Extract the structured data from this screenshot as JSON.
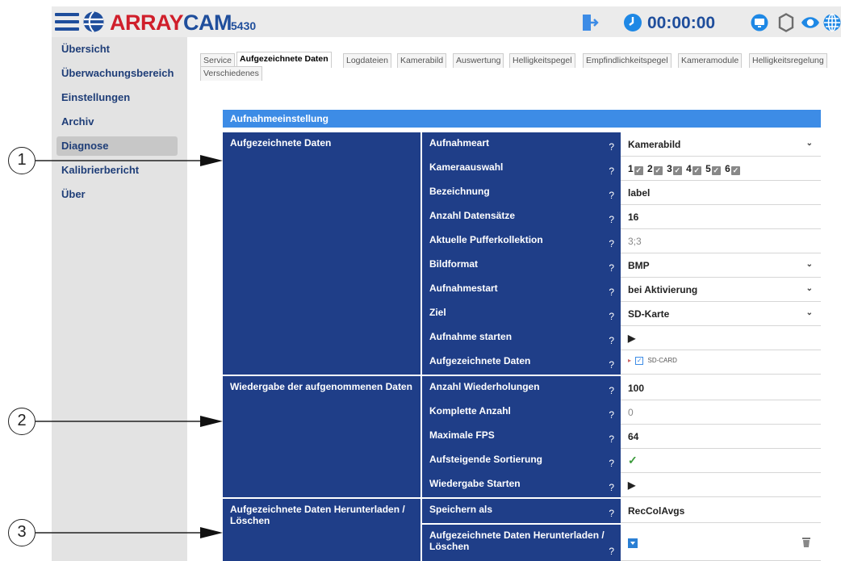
{
  "header": {
    "brand_first": "ARRAY",
    "brand_second": "CAM",
    "model": "5430",
    "timer": "00:00:00",
    "colors": {
      "brand_red": "#d01f2b",
      "brand_blue": "#1f4e9c",
      "accent": "#1e88e5"
    },
    "icons": [
      "menu-icon",
      "globe-logo-icon",
      "logout-icon",
      "clock-icon",
      "monitor-icon",
      "gear-icon",
      "eye-icon",
      "language-globe-icon"
    ]
  },
  "sidebar": {
    "items": [
      {
        "label": "Übersicht"
      },
      {
        "label": "Überwachungsbereich"
      },
      {
        "label": "Einstellungen"
      },
      {
        "label": "Archiv"
      },
      {
        "label": "Diagnose",
        "active": true
      },
      {
        "label": "Kalibrierbericht"
      },
      {
        "label": "Über"
      }
    ]
  },
  "tabs": [
    {
      "label": "Service"
    },
    {
      "label": "Aufgezeichnete Daten",
      "active": true
    },
    {
      "label": "Logdateien"
    },
    {
      "label": "Kamerabild"
    },
    {
      "label": "Auswertung"
    },
    {
      "label": "Helligkeitspegel"
    },
    {
      "label": "Empfindlichkeitspegel"
    },
    {
      "label": "Kameramodule"
    },
    {
      "label": "Helligkeitsregelung"
    },
    {
      "label": "Verschiedenes"
    }
  ],
  "panel": {
    "title": "Aufnahmeeinstellung",
    "help_symbol": "?",
    "sections": [
      {
        "label": "Aufgezeichnete Daten",
        "rows": [
          {
            "label": "Aufnahmeart",
            "value": "Kamerabild",
            "dropdown": true
          },
          {
            "label": "Kameraauswahl",
            "cameras": [
              "1",
              "2",
              "3",
              "4",
              "5",
              "6"
            ]
          },
          {
            "label": "Bezeichnung",
            "value": "label"
          },
          {
            "label": "Anzahl Datensätze",
            "value": "16"
          },
          {
            "label": "Aktuelle Pufferkollektion",
            "value": "3;3"
          },
          {
            "label": "Bildformat",
            "value": "BMP",
            "dropdown": true
          },
          {
            "label": "Aufnahmestart",
            "value": "bei Aktivierung",
            "dropdown": true
          },
          {
            "label": "Ziel",
            "value": "SD-Karte",
            "dropdown": true
          },
          {
            "label": "Aufnahme starten",
            "value": "▶"
          },
          {
            "label": "Aufgezeichnete Daten",
            "value": "SD-CARD"
          }
        ]
      },
      {
        "label": "Wiedergabe der aufgenommenen Daten",
        "rows": [
          {
            "label": "Anzahl Wiederholungen",
            "value": "100"
          },
          {
            "label": "Komplette Anzahl",
            "value": "0"
          },
          {
            "label": "Maximale FPS",
            "value": "64"
          },
          {
            "label": "Aufsteigende Sortierung",
            "value": "✓"
          },
          {
            "label": "Wiedergabe Starten",
            "value": "▶"
          }
        ]
      },
      {
        "label": "Aufgezeichnete Daten Herunterladen / Löschen",
        "rows": [
          {
            "label": "Speichern als",
            "value": "RecColAvgs"
          },
          {
            "label": "Aufgezeichnete Daten Herunterladen / Löschen"
          }
        ]
      }
    ]
  },
  "callouts": [
    "1",
    "2",
    "3"
  ]
}
